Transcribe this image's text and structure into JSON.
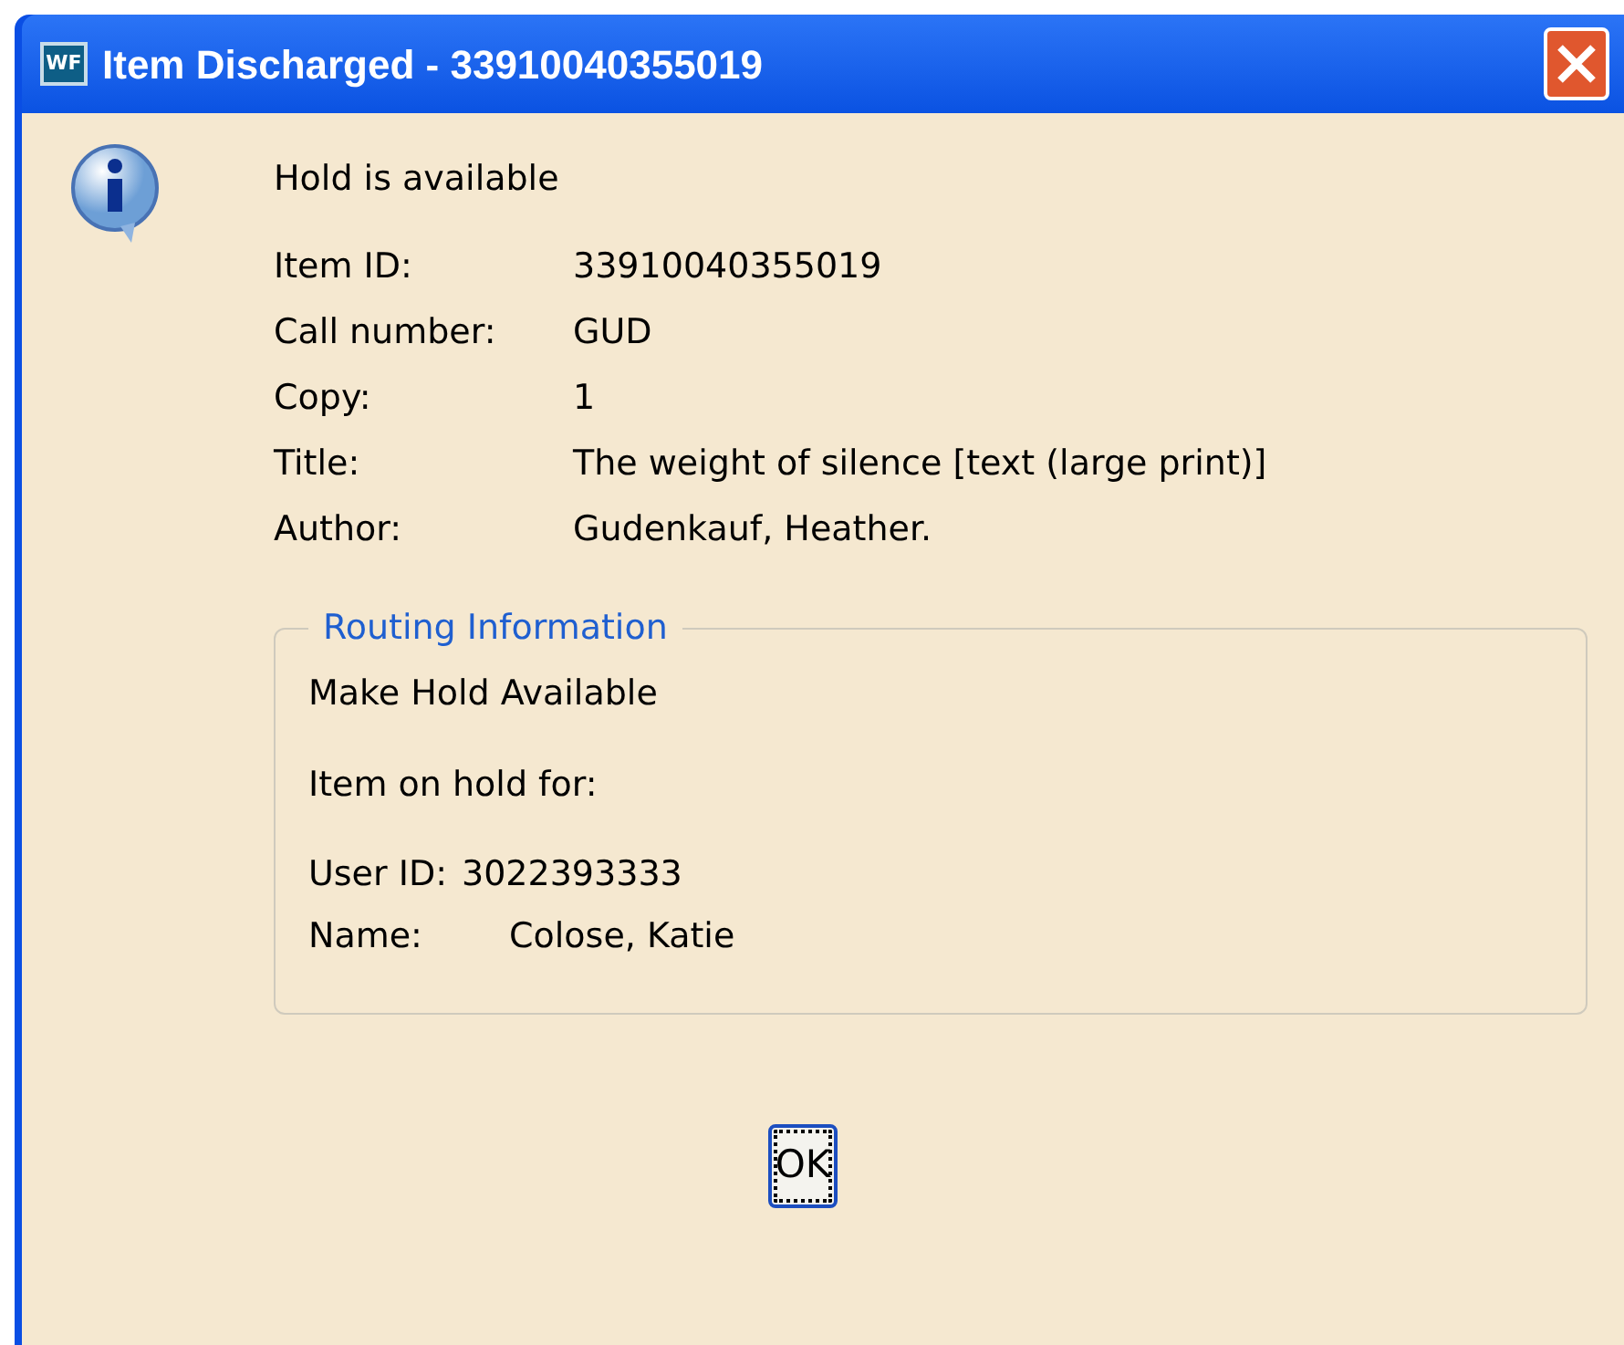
{
  "window": {
    "app_icon_text": "WF",
    "title": "Item Discharged - 33910040355019"
  },
  "message": "Hold is available",
  "fields": [
    {
      "label": "Item ID:",
      "value": "33910040355019"
    },
    {
      "label": "Call number:",
      "value": "GUD"
    },
    {
      "label": "Copy:",
      "value": "1"
    },
    {
      "label": "Title:",
      "value": "The weight of silence [text (large print)]"
    },
    {
      "label": "Author:",
      "value": "Gudenkauf, Heather."
    }
  ],
  "routing": {
    "legend": "Routing Information",
    "action": "Make Hold Available",
    "hold_for": "Item on hold for:",
    "user": [
      {
        "label": "User ID:",
        "value": "3022393333"
      },
      {
        "label": "Name:",
        "value": "Colose, Katie"
      }
    ]
  },
  "buttons": [
    {
      "label": "OK",
      "focused": true
    }
  ]
}
